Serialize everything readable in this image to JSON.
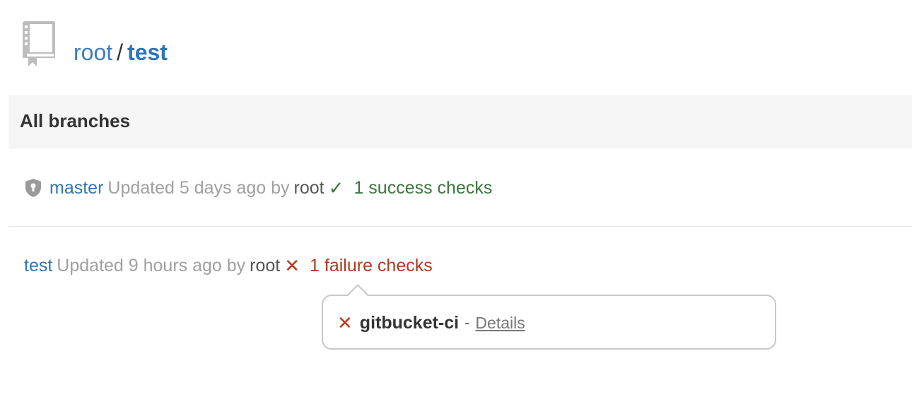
{
  "repo": {
    "owner": "root",
    "separator": "/",
    "name": "test",
    "icon": "repo-book-icon"
  },
  "branches_panel": {
    "heading": "All branches"
  },
  "branches": [
    {
      "name": "master",
      "protected": true,
      "protected_icon": "shield-lock-icon",
      "updated": "Updated 5 days ago by",
      "user": "root",
      "status_icon": "✓",
      "status_text": "1 success checks",
      "status_color": "#3c763d"
    },
    {
      "name": "test",
      "protected": false,
      "updated": "Updated 9 hours ago by",
      "user": "root",
      "status_icon": "✕",
      "status_text": "1 failure checks",
      "status_color": "#c0351a"
    }
  ],
  "popover": {
    "icon": "✕",
    "check_name": "gitbucket-ci",
    "separator": "-",
    "link_label": "Details"
  }
}
